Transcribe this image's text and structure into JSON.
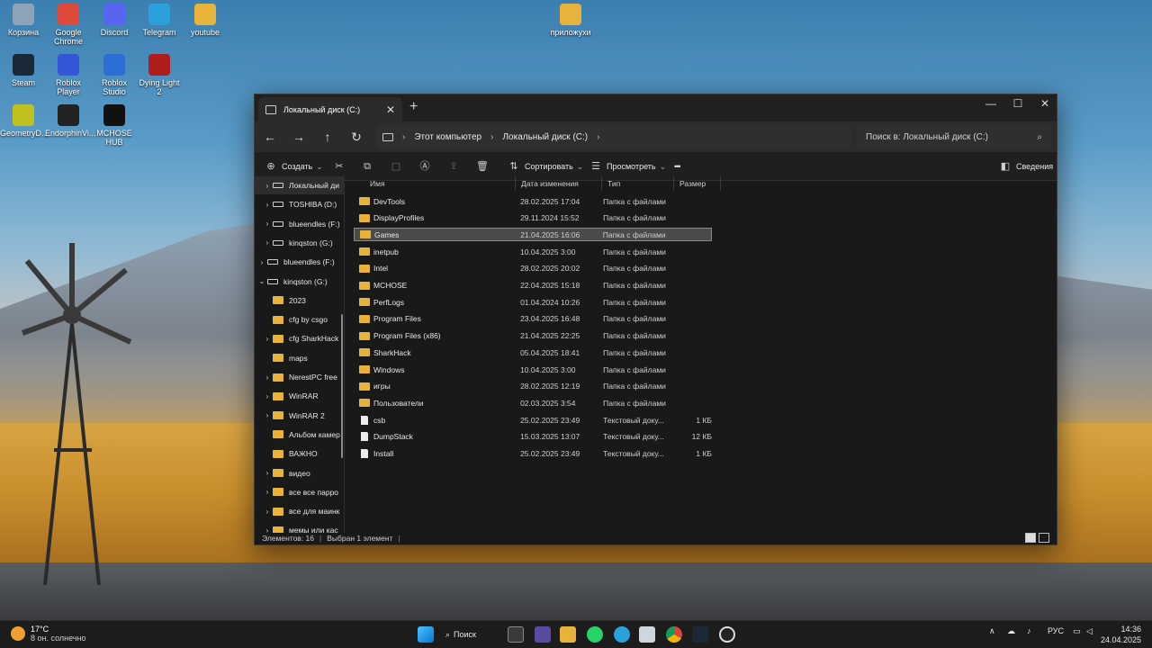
{
  "desktop": {
    "icons": [
      {
        "label": "Корзина",
        "icon": "recycle-bin-icon"
      },
      {
        "label": "Google Chrome",
        "icon": "chrome-icon"
      },
      {
        "label": "Discord",
        "icon": "discord-icon"
      },
      {
        "label": "Telegram",
        "icon": "telegram-icon"
      },
      {
        "label": "youtube",
        "icon": "folder-icon"
      },
      {
        "label": "приложухи",
        "icon": "folder-icon"
      },
      {
        "label": "Steam",
        "icon": "steam-icon"
      },
      {
        "label": "Roblox Player",
        "icon": "roblox-icon"
      },
      {
        "label": "Roblox Studio",
        "icon": "roblox-studio-icon"
      },
      {
        "label": "Dying Light 2",
        "icon": "dying-light-icon"
      },
      {
        "label": "GeometryD...",
        "icon": "geometry-dash-icon"
      },
      {
        "label": "EndorphinVi...",
        "icon": "endorphin-icon"
      },
      {
        "label": "MCHOSE HUB",
        "icon": "mchose-icon"
      }
    ]
  },
  "window": {
    "tab_title": "Локальный диск (C:)",
    "tab_close": "✕",
    "new_tab": "+",
    "controls": {
      "minimize": "—",
      "maximize": "☐",
      "close": "✕"
    },
    "nav": {
      "back": "←",
      "forward": "→",
      "up": "↑",
      "refresh": "↻"
    },
    "breadcrumb": [
      "Этот компьютер",
      "Локальный диск (C:)"
    ],
    "breadcrumb_sep": "›",
    "search_placeholder": "Поиск в: Локальный диск (C:)",
    "toolbar": {
      "create": "Создать",
      "sort": "Сортировать",
      "view": "Просмотреть",
      "more": "•••",
      "details": "Сведения"
    },
    "sidebar": [
      {
        "label": "Локальный ди",
        "type": "drive",
        "chev": "›",
        "indent": 1,
        "selected": true
      },
      {
        "label": "TOSHIBA (D:)",
        "type": "drive",
        "chev": "›",
        "indent": 1
      },
      {
        "label": "blueendles (F:)",
        "type": "drive",
        "chev": "›",
        "indent": 1
      },
      {
        "label": "kinqston (G:)",
        "type": "drive",
        "chev": "›",
        "indent": 1
      },
      {
        "label": "blueendles (F:)",
        "type": "drive",
        "chev": "›",
        "indent": 0
      },
      {
        "label": "kinqston (G:)",
        "type": "drive",
        "chev": "⌄",
        "indent": 0
      },
      {
        "label": "2023",
        "type": "folder",
        "chev": "",
        "indent": 1
      },
      {
        "label": "cfg by csgo",
        "type": "folder",
        "chev": "",
        "indent": 1
      },
      {
        "label": "cfg SharkHack",
        "type": "folder",
        "chev": "›",
        "indent": 1
      },
      {
        "label": "maps",
        "type": "folder",
        "chev": "",
        "indent": 1
      },
      {
        "label": "NerestPC free",
        "type": "folder",
        "chev": "›",
        "indent": 1
      },
      {
        "label": "WinRAR",
        "type": "folder",
        "chev": "›",
        "indent": 1
      },
      {
        "label": "WinRAR 2",
        "type": "folder",
        "chev": "›",
        "indent": 1
      },
      {
        "label": "Альбом камер",
        "type": "folder",
        "chev": "",
        "indent": 1
      },
      {
        "label": "ВАЖНО",
        "type": "folder",
        "chev": "",
        "indent": 1
      },
      {
        "label": "видео",
        "type": "folder",
        "chev": "›",
        "indent": 1
      },
      {
        "label": "все все парро",
        "type": "folder",
        "chev": "›",
        "indent": 1
      },
      {
        "label": "все для маинк",
        "type": "folder",
        "chev": "›",
        "indent": 1
      },
      {
        "label": "мемы или кас",
        "type": "folder",
        "chev": "›",
        "indent": 1
      }
    ],
    "columns": {
      "name": "Имя",
      "date": "Дата изменения",
      "type": "Тип",
      "size": "Размер"
    },
    "files": [
      {
        "name": "DevTools",
        "date": "28.02.2025 17:04",
        "type": "Папка с файлами",
        "size": "",
        "kind": "folder"
      },
      {
        "name": "DisplayProfiles",
        "date": "29.11.2024 15:52",
        "type": "Папка с файлами",
        "size": "",
        "kind": "folder"
      },
      {
        "name": "Games",
        "date": "21.04.2025 16:06",
        "type": "Папка с файлами",
        "size": "",
        "kind": "folder",
        "selected": true
      },
      {
        "name": "inetpub",
        "date": "10.04.2025 3:00",
        "type": "Папка с файлами",
        "size": "",
        "kind": "folder"
      },
      {
        "name": "Intel",
        "date": "28.02.2025 20:02",
        "type": "Папка с файлами",
        "size": "",
        "kind": "folder"
      },
      {
        "name": "MCHOSE",
        "date": "22.04.2025 15:18",
        "type": "Папка с файлами",
        "size": "",
        "kind": "folder"
      },
      {
        "name": "PerfLogs",
        "date": "01.04.2024 10:26",
        "type": "Папка с файлами",
        "size": "",
        "kind": "folder"
      },
      {
        "name": "Program Files",
        "date": "23.04.2025 16:48",
        "type": "Папка с файлами",
        "size": "",
        "kind": "folder"
      },
      {
        "name": "Program Files (x86)",
        "date": "21.04.2025 22:25",
        "type": "Папка с файлами",
        "size": "",
        "kind": "folder"
      },
      {
        "name": "SharkHack",
        "date": "05.04.2025 18:41",
        "type": "Папка с файлами",
        "size": "",
        "kind": "folder"
      },
      {
        "name": "Windows",
        "date": "10.04.2025 3:00",
        "type": "Папка с файлами",
        "size": "",
        "kind": "folder"
      },
      {
        "name": "игры",
        "date": "28.02.2025 12:19",
        "type": "Папка с файлами",
        "size": "",
        "kind": "folder"
      },
      {
        "name": "Пользователи",
        "date": "02.03.2025 3:54",
        "type": "Папка с файлами",
        "size": "",
        "kind": "folder"
      },
      {
        "name": "csb",
        "date": "25.02.2025 23:49",
        "type": "Текстовый доку...",
        "size": "1 КБ",
        "kind": "file"
      },
      {
        "name": "DumpStack",
        "date": "15.03.2025 13:07",
        "type": "Текстовый доку...",
        "size": "12 КБ",
        "kind": "file"
      },
      {
        "name": "Install",
        "date": "25.02.2025 23:49",
        "type": "Текстовый доку...",
        "size": "1 КБ",
        "kind": "file"
      }
    ],
    "status": {
      "count": "Элементов: 16",
      "selected": "Выбран 1 элемент"
    }
  },
  "taskbar": {
    "weather_temp": "17°C",
    "weather_desc": "8 он. солнечно",
    "search_label": "Поиск",
    "tray_lang": "РУС",
    "tray_chevron": "∧",
    "time": "14:36",
    "date": "24.04.2025"
  },
  "colors": {
    "accent": "#0078d4",
    "folder": "#e8b33a",
    "window_bg": "#191919"
  }
}
